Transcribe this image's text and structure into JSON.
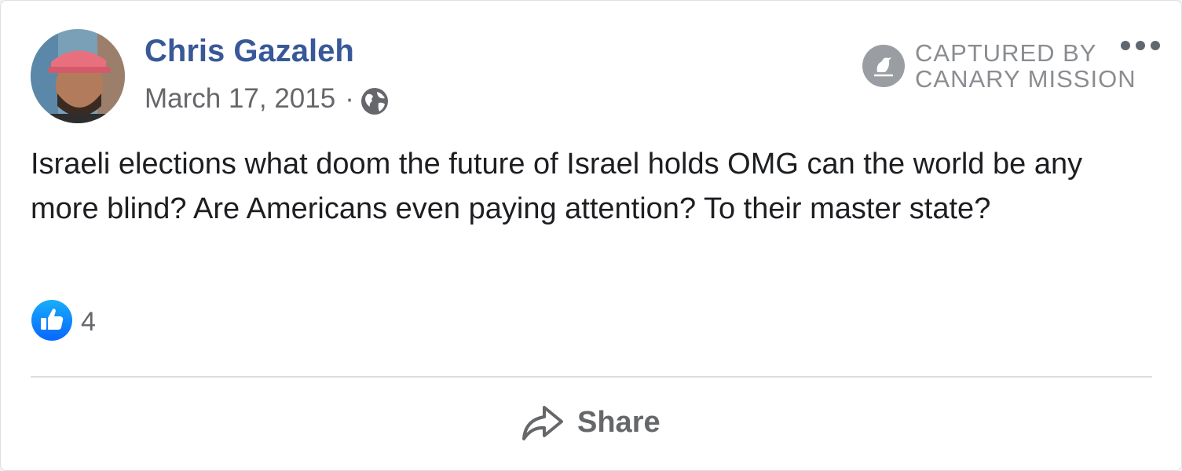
{
  "post": {
    "author": "Chris Gazaleh",
    "date": "March 17, 2015",
    "separator": "·",
    "audience_icon": "globe-icon",
    "text": "Israeli elections what doom the future of Israel holds OMG can the world be any more blind? Are Americans even paying attention? To their master state?",
    "reactions": {
      "icon": "like-icon",
      "count": "4"
    },
    "actions": {
      "share_label": "Share"
    }
  },
  "watermark": {
    "line1": "CAPTURED BY",
    "line2": "CANARY MISSION"
  },
  "colors": {
    "author_link": "#385898",
    "muted_text": "#65676b",
    "like_blue": "#1877f2",
    "watermark_gray": "#8a8d91"
  }
}
